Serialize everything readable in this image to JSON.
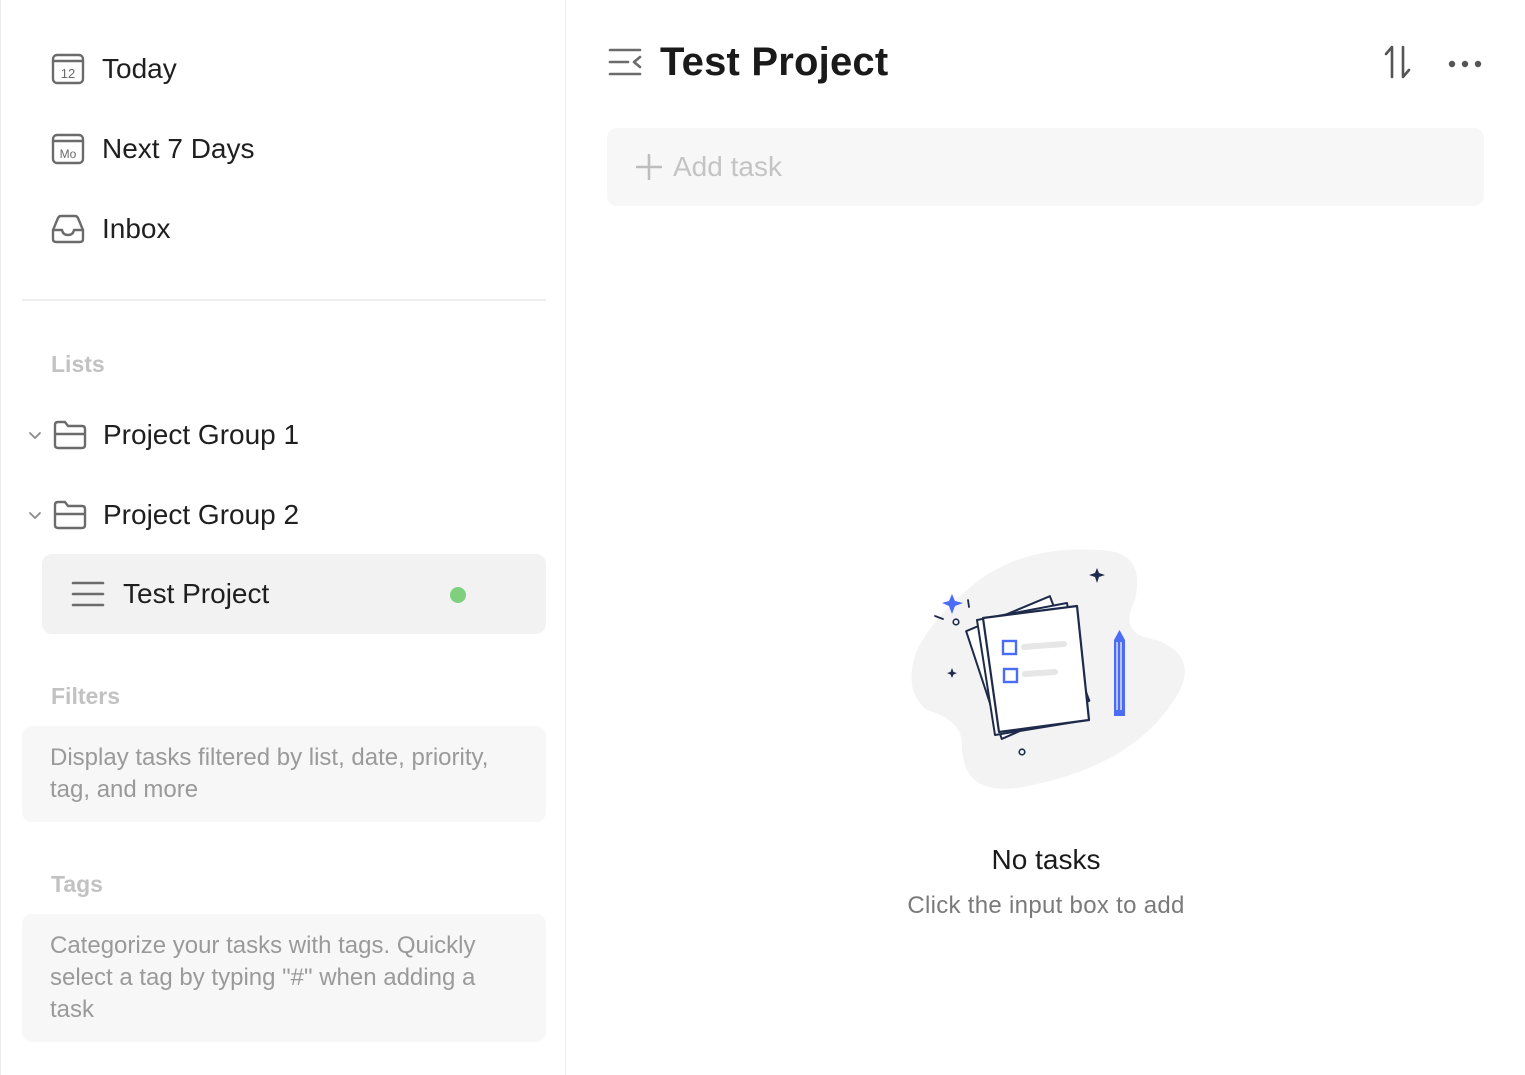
{
  "sidebar": {
    "nav": [
      {
        "label": "Today",
        "icon": "calendar-today-icon",
        "badge": "12"
      },
      {
        "label": "Next 7 Days",
        "icon": "calendar-week-icon",
        "badge": "Mo"
      },
      {
        "label": "Inbox",
        "icon": "inbox-icon"
      }
    ],
    "lists_title": "Lists",
    "groups": [
      {
        "label": "Project Group 1",
        "icon": "folder-icon"
      },
      {
        "label": "Project Group 2",
        "icon": "folder-icon"
      }
    ],
    "active_project": {
      "label": "Test Project",
      "icon": "list-icon",
      "dot_color": "#7ed07f"
    },
    "filters_title": "Filters",
    "filters_hint": "Display tasks filtered by list, date, priority, tag, and more",
    "tags_title": "Tags",
    "tags_hint": "Categorize your tasks with tags. Quickly select a tag by typing \"#\" when adding a task"
  },
  "main": {
    "title": "Test Project",
    "add_task_placeholder": "Add task",
    "empty_title": "No tasks",
    "empty_subtitle": "Click the input box to add"
  },
  "colors": {
    "accent": "#4a6cf7",
    "dark_navy": "#1e2a4a",
    "active_bg": "#f2f2f2",
    "hint_bg": "#f7f7f7"
  }
}
